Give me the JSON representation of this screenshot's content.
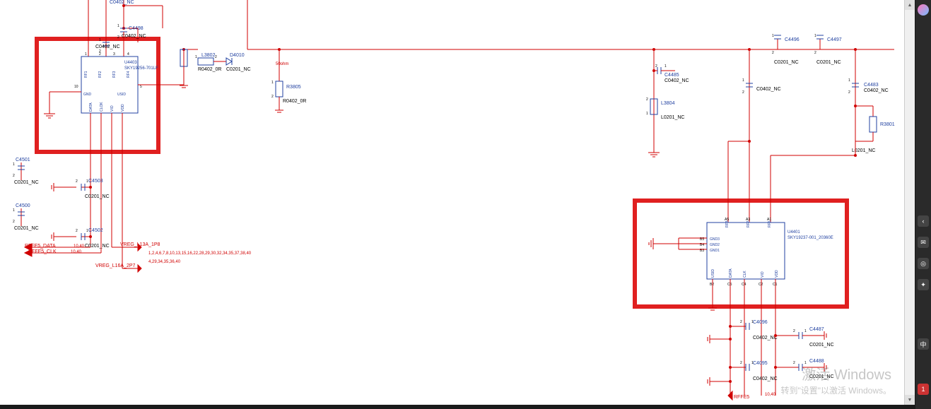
{
  "chips": {
    "U4403": {
      "ref": "U4403",
      "part": "SKY19256-701LF",
      "left_pins": [
        {
          "n": "10",
          "name": "DATA"
        },
        {
          "n": "",
          "name": "CLOK"
        },
        {
          "n": "",
          "name": "VIO"
        },
        {
          "n": "",
          "name": "VDD"
        }
      ],
      "right_pins": [
        {
          "n": "5",
          "name": "USID"
        }
      ],
      "top_pins": [
        {
          "n": "1",
          "name": "RF1"
        },
        {
          "n": "2",
          "name": "RF2"
        },
        {
          "n": "3",
          "name": "RF3"
        },
        {
          "n": "4",
          "name": "RF4"
        }
      ],
      "bottom_left": "GND"
    },
    "U4401": {
      "ref": "U4401",
      "part": "SKY19237-001_20360E",
      "left_pins": [
        {
          "n": "B5",
          "name": "GND3"
        },
        {
          "n": "B4",
          "name": "GND2"
        },
        {
          "n": "B3",
          "name": "GND1"
        }
      ],
      "top_pins": [
        {
          "n": "A5",
          "name": "RF3"
        },
        {
          "n": "A3",
          "name": "RF2"
        },
        {
          "n": "A1",
          "name": "RF1"
        }
      ],
      "bottom_pins": [
        {
          "n": "B2",
          "name": "USID"
        },
        {
          "n": "C5",
          "name": "DATA"
        },
        {
          "n": "C4",
          "name": "CLK"
        },
        {
          "n": "C2",
          "name": "VIO"
        },
        {
          "n": "C1",
          "name": "VDD"
        }
      ]
    }
  },
  "components": {
    "C4499": {
      "ref": "C4499",
      "val": "C0402_NC"
    },
    "C4498": {
      "ref": "C4498"
    },
    "top_nc": {
      "val": "C0402_NC"
    },
    "cap_nc": {
      "val": "C0402_NC"
    },
    "L3802": {
      "ref": "L3802",
      "val": "R0402_0R"
    },
    "D4010": {
      "ref": "D4010",
      "val": "C0201_NC"
    },
    "R3805": {
      "ref": "R3805",
      "val": "R0402_0R"
    },
    "C4501": {
      "ref": "C4501",
      "val": "C0201_NC"
    },
    "C4500": {
      "ref": "C4500",
      "val": "C0201_NC"
    },
    "C4503": {
      "ref": "C4503",
      "val": "C0201_NC"
    },
    "C4502": {
      "ref": "C4502",
      "val": "C0201_NC"
    },
    "pins_c4502": {
      "a": "2",
      "b": "1"
    },
    "ann_1040": "10,40",
    "C4496": {
      "ref": "C4496",
      "val": "C0201_NC"
    },
    "C4497": {
      "ref": "C4497",
      "val": "C0201_NC"
    },
    "C4485": {
      "ref": "C4485",
      "val": "C0402_NC"
    },
    "L3804": {
      "ref": "L3804",
      "val": "L0201_NC"
    },
    "C4483": {
      "ref": "C4483",
      "val": "C0402_NC"
    },
    "R3801": {
      "ref": "R3801",
      "val": "L0201_NC"
    },
    "cap_mid": {
      "val": "C0402_NC"
    },
    "C4096": {
      "ref": "C4096",
      "val": "C0402_NC"
    },
    "C4095": {
      "ref": "C4095",
      "val": "C0402_NC"
    },
    "C4487": {
      "ref": "C4487",
      "val": "C0201_NC"
    },
    "C4488": {
      "ref": "C4488",
      "val": "C0201_NC"
    }
  },
  "nets": {
    "rffe5_data": "RFFE5_DATA",
    "rffe5_clk": "RFFE5_CLK",
    "rffe_bottom": "RFFE5",
    "vreg1": "VREG_L13A_1P8",
    "vreg2": "VREG_L16A_2P7",
    "ohms": "50ohm"
  },
  "notes": {
    "list1": "1,2,4,6,7,8,10,13,15,16,22,28,29,30,32,34,35,37,38,40",
    "list2": "4,29,34,35,36,40",
    "b1040": "10,40"
  },
  "sidebar": {
    "ime": "中",
    "num": "1"
  },
  "watermark": {
    "l1": "激活 Windows",
    "l2": "转到\"设置\"以激活 Windows。"
  }
}
